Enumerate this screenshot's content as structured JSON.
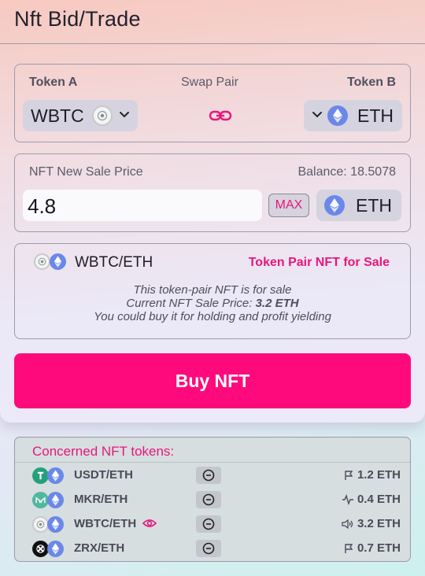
{
  "header": {
    "title": "Nft Bid/Trade"
  },
  "pair": {
    "token_a_label": "Token A",
    "swap_pair_label": "Swap Pair",
    "token_b_label": "Token B",
    "token_a_value": "WBTC",
    "token_b_value": "ETH",
    "token_a_icon": "wbtc-icon",
    "token_b_icon": "eth-icon",
    "link_icon": "link-icon"
  },
  "price": {
    "label": "NFT New Sale Price",
    "balance": "Balance: 18.5078",
    "value": "4.8",
    "max_label": "MAX",
    "currency": "ETH"
  },
  "info": {
    "pair_name": "WBTC/ETH",
    "badge": "Token Pair NFT for Sale",
    "line1": "This token-pair NFT is for sale",
    "line2_prefix": "Current NFT Sale Price: ",
    "line2_value": "3.2 ETH",
    "line3": "You could buy it for holding and profit yielding"
  },
  "buy_label": "Buy NFT",
  "concerned": {
    "title": "Concerned NFT tokens:",
    "rows": [
      {
        "name": "USDT/ETH",
        "value": "1.2 ETH",
        "status_icon": "flag-icon",
        "coin": "tether"
      },
      {
        "name": "MKR/ETH",
        "value": "0.4 ETH",
        "status_icon": "activity-icon",
        "coin": "mkr"
      },
      {
        "name": "WBTC/ETH",
        "value": "3.2 ETH",
        "status_icon": "speaker-icon",
        "coin": "wbtc"
      },
      {
        "name": "ZRX/ETH",
        "value": "0.7 ETH",
        "status_icon": "flag-icon",
        "coin": "zrx"
      }
    ]
  },
  "colors": {
    "accent": "#ff0a7c",
    "eth": "#6b88e8"
  }
}
